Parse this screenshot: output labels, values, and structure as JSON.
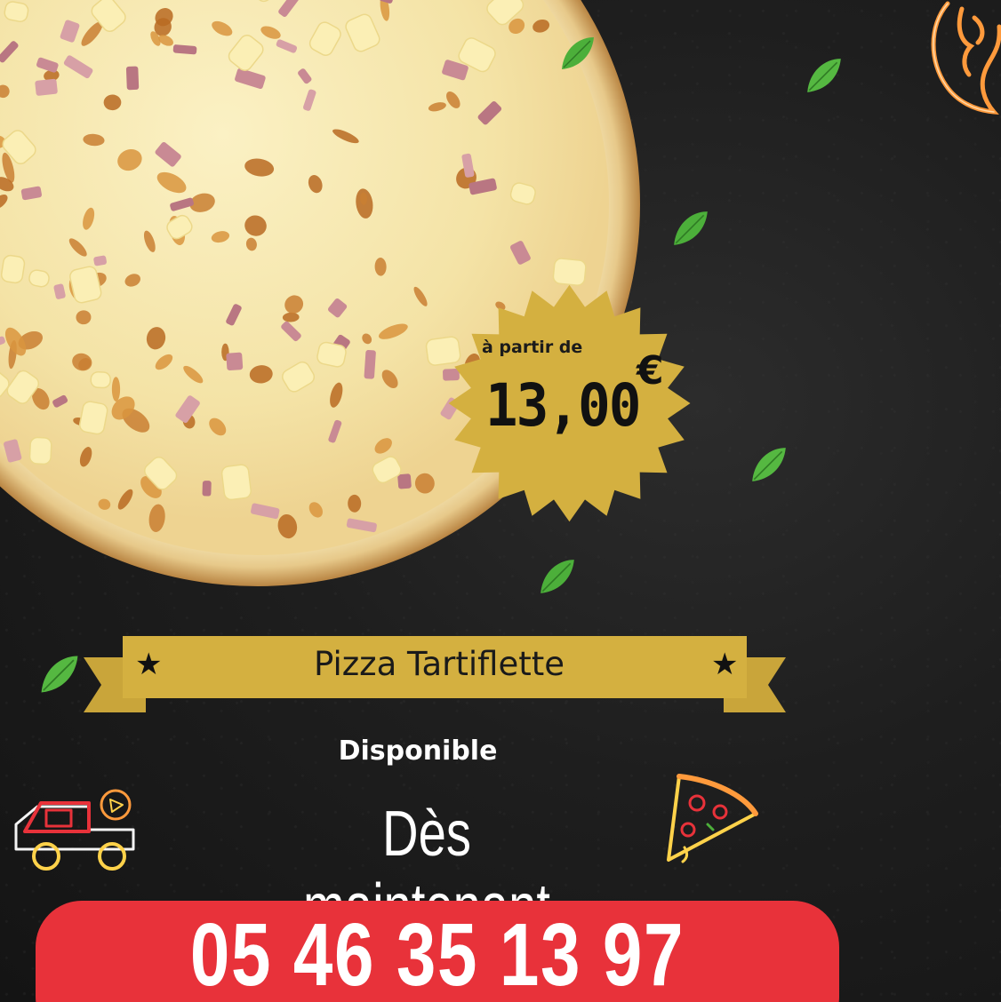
{
  "product": {
    "name": "Pizza Tartiflette",
    "price_prefix": "à partir de",
    "price": "13,00",
    "currency": "€"
  },
  "availability": {
    "line1": "Disponible",
    "line2": "Dès maintenant"
  },
  "contact": {
    "phone": "05 46 35 13 97"
  },
  "decor": {
    "ribbon_star": "★",
    "icons": [
      "delivery-truck-icon",
      "pizza-slice-icon",
      "flame-logo-icon",
      "basil-leaf-icon"
    ]
  },
  "colors": {
    "background": "#1b1b1b",
    "gold": "#d4b040",
    "phone_bg": "#e8323a",
    "neon_orange": "#ff9a3c",
    "leaf_green": "#4caf3a"
  }
}
